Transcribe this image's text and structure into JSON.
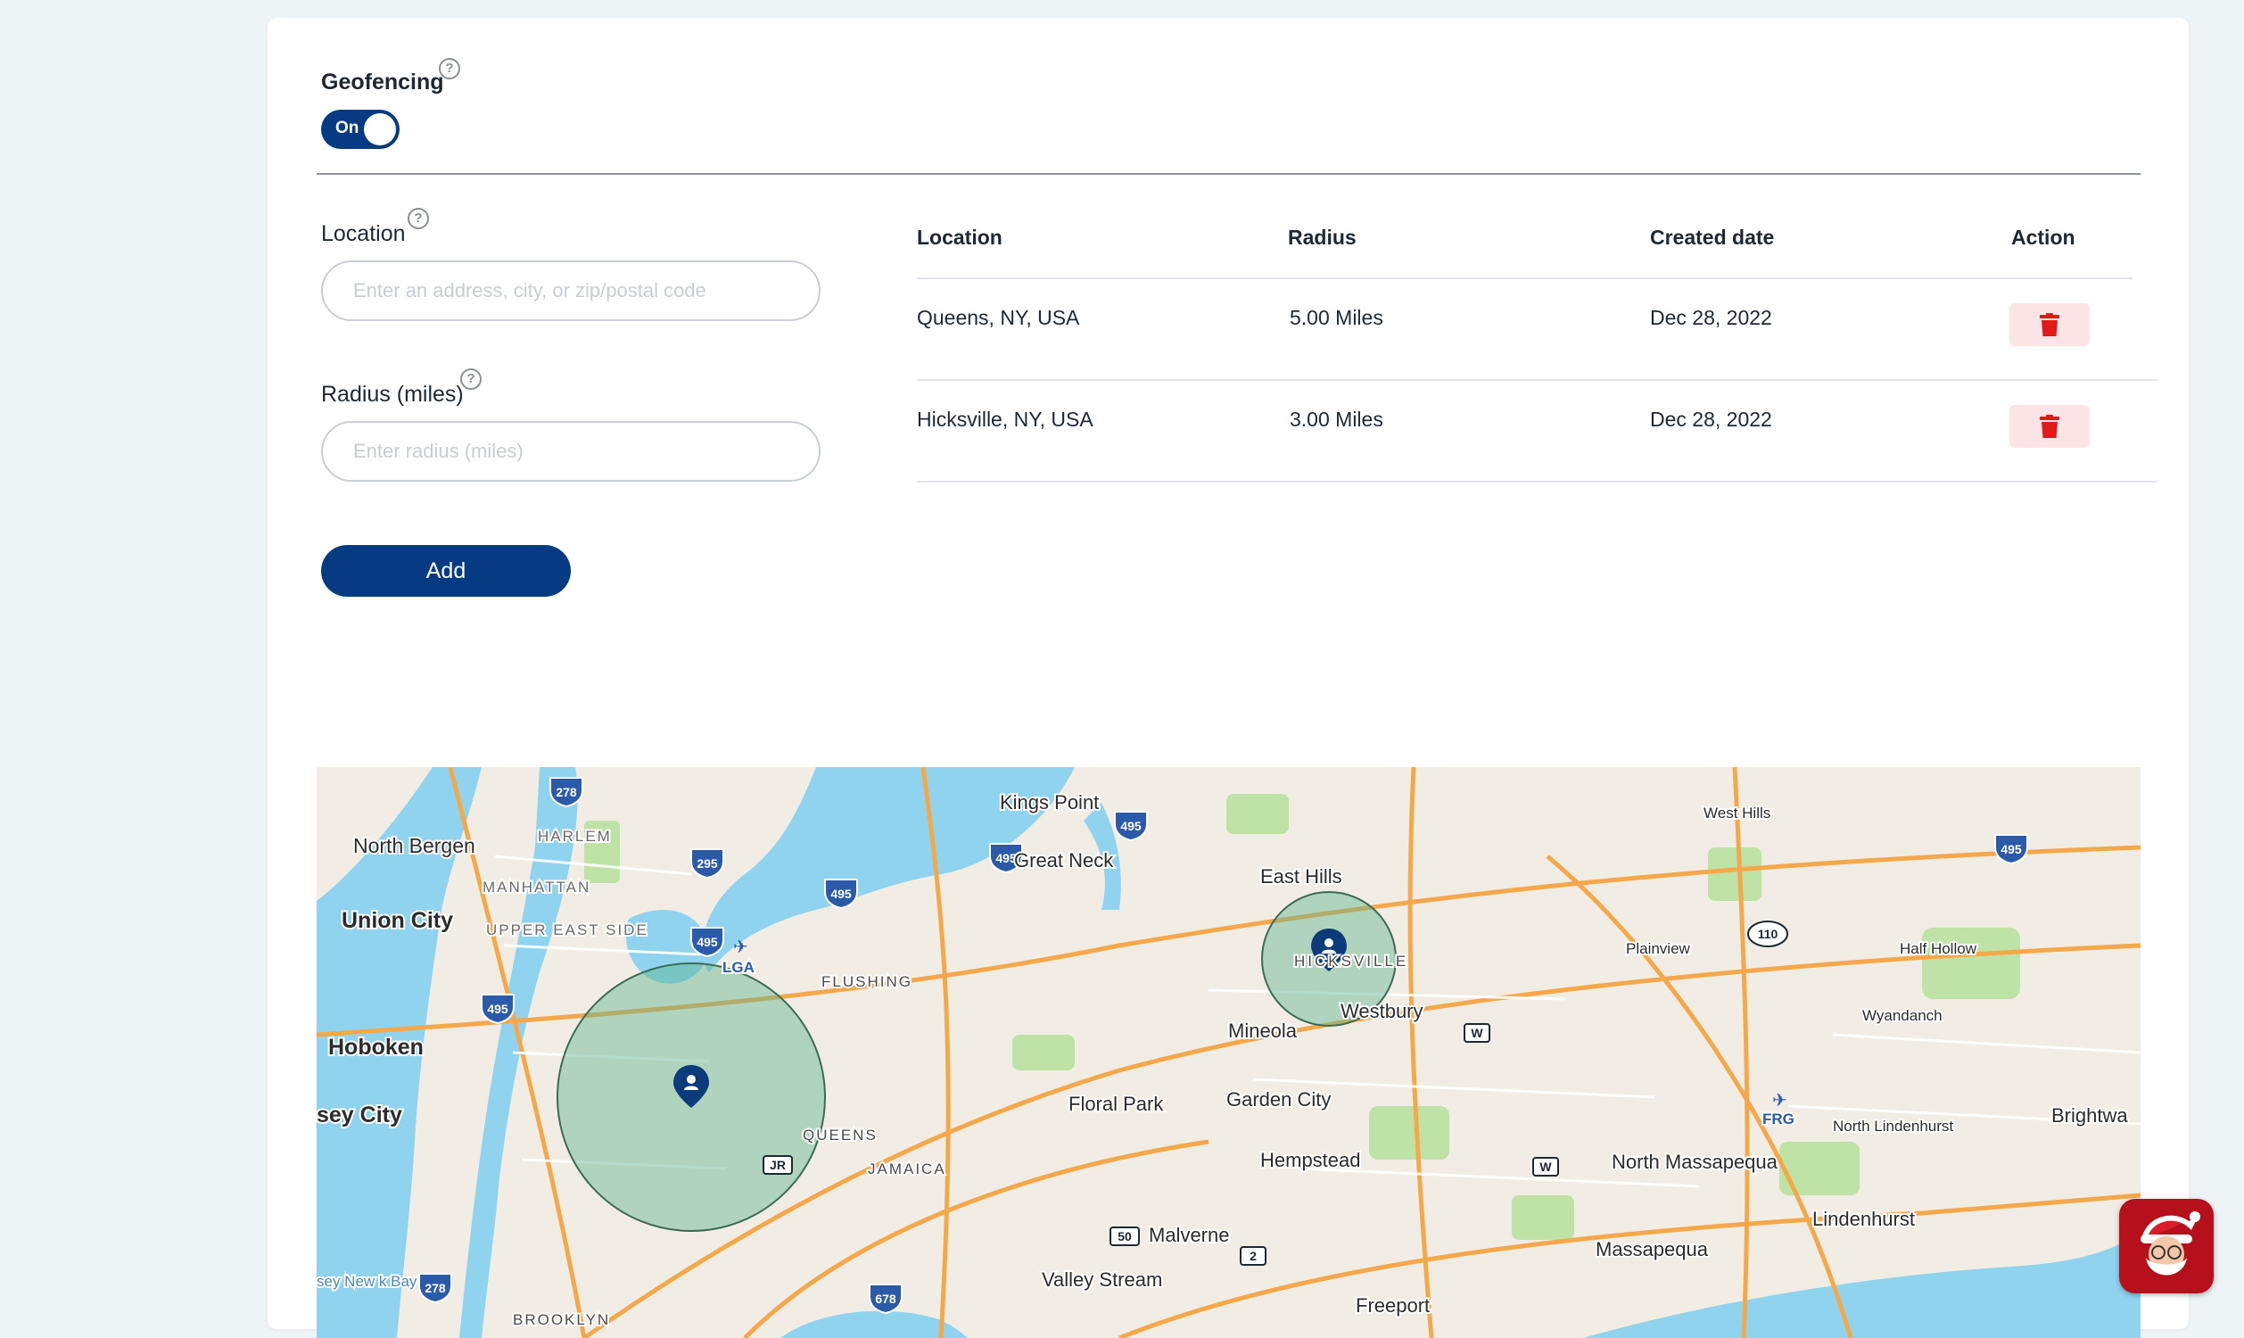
{
  "geofencing": {
    "title": "Geofencing",
    "toggle_label": "On",
    "enabled": true
  },
  "form": {
    "location_label": "Location",
    "location_placeholder": "Enter an address, city, or zip/postal code",
    "location_value": "",
    "radius_label": "Radius (miles)",
    "radius_placeholder": "Enter radius (miles)",
    "radius_value": "",
    "add_label": "Add"
  },
  "table": {
    "headers": [
      "Location",
      "Radius",
      "Created date",
      "Action"
    ],
    "rows": [
      {
        "location": "Queens, NY, USA",
        "radius": "5.00 Miles",
        "created": "Dec 28, 2022"
      },
      {
        "location": "Hicksville, NY, USA",
        "radius": "3.00 Miles",
        "created": "Dec 28, 2022"
      }
    ]
  },
  "map": {
    "places": [
      "Kings Point",
      "Great Neck",
      "East Hills",
      "West Hills",
      "North Bergen",
      "HARLEM",
      "MANHATTAN",
      "UPPER EAST SIDE",
      "Union City",
      "LGA",
      "FLUSHING",
      "Hoboken",
      "sey City",
      "QUEENS",
      "JAMAICA",
      "Floral Park",
      "Mineola",
      "Westbury",
      "HICKSVILLE",
      "Plainview",
      "Half Hollow",
      "Wyandanch",
      "Garden City",
      "Hempstead",
      "FRG",
      "North Lindenhurst",
      "Brightwa",
      "North Massapequa",
      "Lindenhurst",
      "Massapequa",
      "Malverne",
      "Valley Stream",
      "Freeport",
      "BROOKLYN",
      "sey New k Bay"
    ],
    "shields": [
      "278",
      "295",
      "495",
      "495",
      "495",
      "495",
      "495",
      "495",
      "278",
      "678",
      "110",
      "W",
      "W",
      "JR",
      "50",
      "2"
    ],
    "water_color": "#8fd3ef",
    "park_color": "#bfe3a6",
    "road_color": "#f4a84a",
    "fence_color": "#5fb38f",
    "pin_color": "#0b3b7a"
  },
  "chat_widget": {
    "icon": "santa-icon",
    "color": "#b5101b"
  }
}
